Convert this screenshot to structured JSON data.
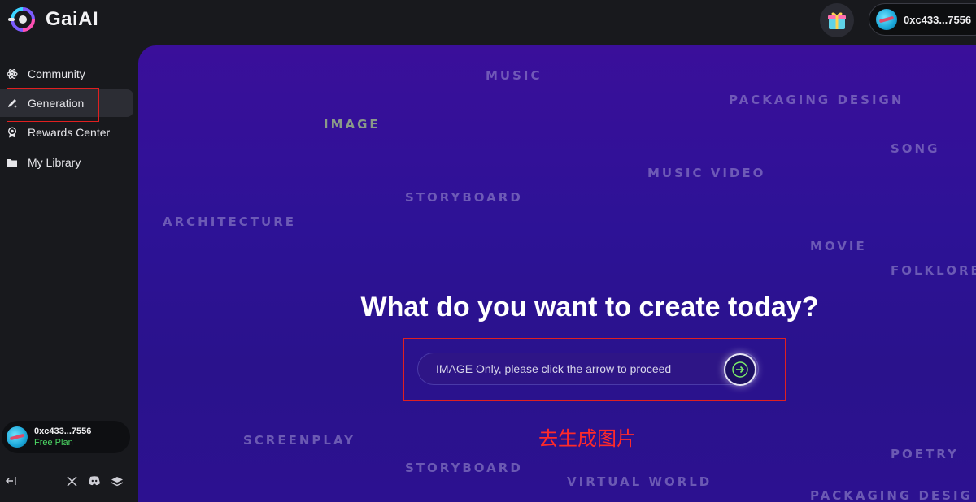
{
  "app": {
    "name": "GaiAI"
  },
  "header": {
    "wallet_address": "0xc433...7556"
  },
  "sidebar": {
    "items": [
      {
        "label": "Community",
        "icon": "atom-icon"
      },
      {
        "label": "Generation",
        "icon": "pen-sparkle-icon",
        "active": true
      },
      {
        "label": "Rewards Center",
        "icon": "medal-icon"
      },
      {
        "label": "My Library",
        "icon": "folder-icon"
      }
    ],
    "user": {
      "address": "0xc433...7556",
      "plan": "Free Plan"
    },
    "footer_icons": [
      "collapse-icon",
      "x-icon",
      "discord-icon",
      "layers-icon"
    ]
  },
  "hero": {
    "tags": [
      "MUSIC",
      "PACKAGING DESIGN",
      "IMAGE",
      "SONG",
      "MUSIC VIDEO",
      "STORYBOARD",
      "ARCHITECTURE",
      "MOVIE",
      "FOLKLORE",
      "SCREENPLAY",
      "POETRY",
      "STORYBOARD",
      "VIRTUAL WORLD",
      "PACKAGING DESIG"
    ],
    "headline": "What do you want to create today?",
    "prompt_placeholder": "IMAGE Only, please click the arrow to proceed",
    "annotation": "去生成图片"
  },
  "colors": {
    "accent_red": "#e02020",
    "plan_green": "#4cd964",
    "hero_purple": "#2d1296"
  }
}
